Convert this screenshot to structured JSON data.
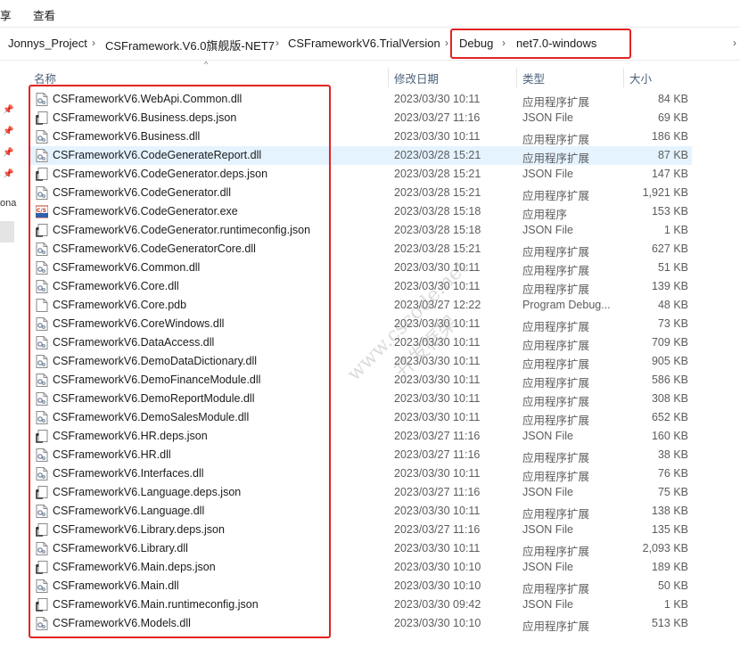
{
  "menu": {
    "items": [
      "享",
      "查看"
    ]
  },
  "breadcrumb": {
    "items": [
      "Jonnys_Project",
      "CSFramework.V6.0旗舰版-NET7",
      "CSFrameworkV6.TrialVersion",
      "Debug",
      "net7.0-windows"
    ]
  },
  "nav": {
    "partial_label": "ona"
  },
  "columns": {
    "name": "名称",
    "date": "修改日期",
    "type": "类型",
    "size": "大小"
  },
  "watermark": {
    "line1": "www.cscode.net",
    "line2": "开发框架"
  },
  "files": [
    {
      "name": "CSFrameworkV6.WebApi.Common.dll",
      "date": "2023/03/30 10:11",
      "type": "应用程序扩展",
      "size": "84 KB",
      "icon": "dll"
    },
    {
      "name": "CSFrameworkV6.Business.deps.json",
      "date": "2023/03/27 11:16",
      "type": "JSON File",
      "size": "69 KB",
      "icon": "json"
    },
    {
      "name": "CSFrameworkV6.Business.dll",
      "date": "2023/03/30 10:11",
      "type": "应用程序扩展",
      "size": "186 KB",
      "icon": "dll"
    },
    {
      "name": "CSFrameworkV6.CodeGenerateReport.dll",
      "date": "2023/03/28 15:21",
      "type": "应用程序扩展",
      "size": "87 KB",
      "icon": "dll",
      "selected": true
    },
    {
      "name": "CSFrameworkV6.CodeGenerator.deps.json",
      "date": "2023/03/28 15:21",
      "type": "JSON File",
      "size": "147 KB",
      "icon": "json"
    },
    {
      "name": "CSFrameworkV6.CodeGenerator.dll",
      "date": "2023/03/28 15:21",
      "type": "应用程序扩展",
      "size": "1,921 KB",
      "icon": "dll"
    },
    {
      "name": "CSFrameworkV6.CodeGenerator.exe",
      "date": "2023/03/28 15:18",
      "type": "应用程序",
      "size": "153 KB",
      "icon": "exe"
    },
    {
      "name": "CSFrameworkV6.CodeGenerator.runtimeconfig.json",
      "date": "2023/03/28 15:18",
      "type": "JSON File",
      "size": "1 KB",
      "icon": "json"
    },
    {
      "name": "CSFrameworkV6.CodeGeneratorCore.dll",
      "date": "2023/03/28 15:21",
      "type": "应用程序扩展",
      "size": "627 KB",
      "icon": "dll"
    },
    {
      "name": "CSFrameworkV6.Common.dll",
      "date": "2023/03/30 10:11",
      "type": "应用程序扩展",
      "size": "51 KB",
      "icon": "dll"
    },
    {
      "name": "CSFrameworkV6.Core.dll",
      "date": "2023/03/30 10:11",
      "type": "应用程序扩展",
      "size": "139 KB",
      "icon": "dll"
    },
    {
      "name": "CSFrameworkV6.Core.pdb",
      "date": "2023/03/27 12:22",
      "type": "Program Debug...",
      "size": "48 KB",
      "icon": "blank"
    },
    {
      "name": "CSFrameworkV6.CoreWindows.dll",
      "date": "2023/03/30 10:11",
      "type": "应用程序扩展",
      "size": "73 KB",
      "icon": "dll"
    },
    {
      "name": "CSFrameworkV6.DataAccess.dll",
      "date": "2023/03/30 10:11",
      "type": "应用程序扩展",
      "size": "709 KB",
      "icon": "dll"
    },
    {
      "name": "CSFrameworkV6.DemoDataDictionary.dll",
      "date": "2023/03/30 10:11",
      "type": "应用程序扩展",
      "size": "905 KB",
      "icon": "dll"
    },
    {
      "name": "CSFrameworkV6.DemoFinanceModule.dll",
      "date": "2023/03/30 10:11",
      "type": "应用程序扩展",
      "size": "586 KB",
      "icon": "dll"
    },
    {
      "name": "CSFrameworkV6.DemoReportModule.dll",
      "date": "2023/03/30 10:11",
      "type": "应用程序扩展",
      "size": "308 KB",
      "icon": "dll"
    },
    {
      "name": "CSFrameworkV6.DemoSalesModule.dll",
      "date": "2023/03/30 10:11",
      "type": "应用程序扩展",
      "size": "652 KB",
      "icon": "dll"
    },
    {
      "name": "CSFrameworkV6.HR.deps.json",
      "date": "2023/03/27 11:16",
      "type": "JSON File",
      "size": "160 KB",
      "icon": "json"
    },
    {
      "name": "CSFrameworkV6.HR.dll",
      "date": "2023/03/27 11:16",
      "type": "应用程序扩展",
      "size": "38 KB",
      "icon": "dll"
    },
    {
      "name": "CSFrameworkV6.Interfaces.dll",
      "date": "2023/03/30 10:11",
      "type": "应用程序扩展",
      "size": "76 KB",
      "icon": "dll"
    },
    {
      "name": "CSFrameworkV6.Language.deps.json",
      "date": "2023/03/27 11:16",
      "type": "JSON File",
      "size": "75 KB",
      "icon": "json"
    },
    {
      "name": "CSFrameworkV6.Language.dll",
      "date": "2023/03/30 10:11",
      "type": "应用程序扩展",
      "size": "138 KB",
      "icon": "dll"
    },
    {
      "name": "CSFrameworkV6.Library.deps.json",
      "date": "2023/03/27 11:16",
      "type": "JSON File",
      "size": "135 KB",
      "icon": "json"
    },
    {
      "name": "CSFrameworkV6.Library.dll",
      "date": "2023/03/30 10:11",
      "type": "应用程序扩展",
      "size": "2,093 KB",
      "icon": "dll"
    },
    {
      "name": "CSFrameworkV6.Main.deps.json",
      "date": "2023/03/30 10:10",
      "type": "JSON File",
      "size": "189 KB",
      "icon": "json"
    },
    {
      "name": "CSFrameworkV6.Main.dll",
      "date": "2023/03/30 10:10",
      "type": "应用程序扩展",
      "size": "50 KB",
      "icon": "dll"
    },
    {
      "name": "CSFrameworkV6.Main.runtimeconfig.json",
      "date": "2023/03/30 09:42",
      "type": "JSON File",
      "size": "1 KB",
      "icon": "json"
    },
    {
      "name": "CSFrameworkV6.Models.dll",
      "date": "2023/03/30 10:10",
      "type": "应用程序扩展",
      "size": "513 KB",
      "icon": "dll"
    }
  ]
}
